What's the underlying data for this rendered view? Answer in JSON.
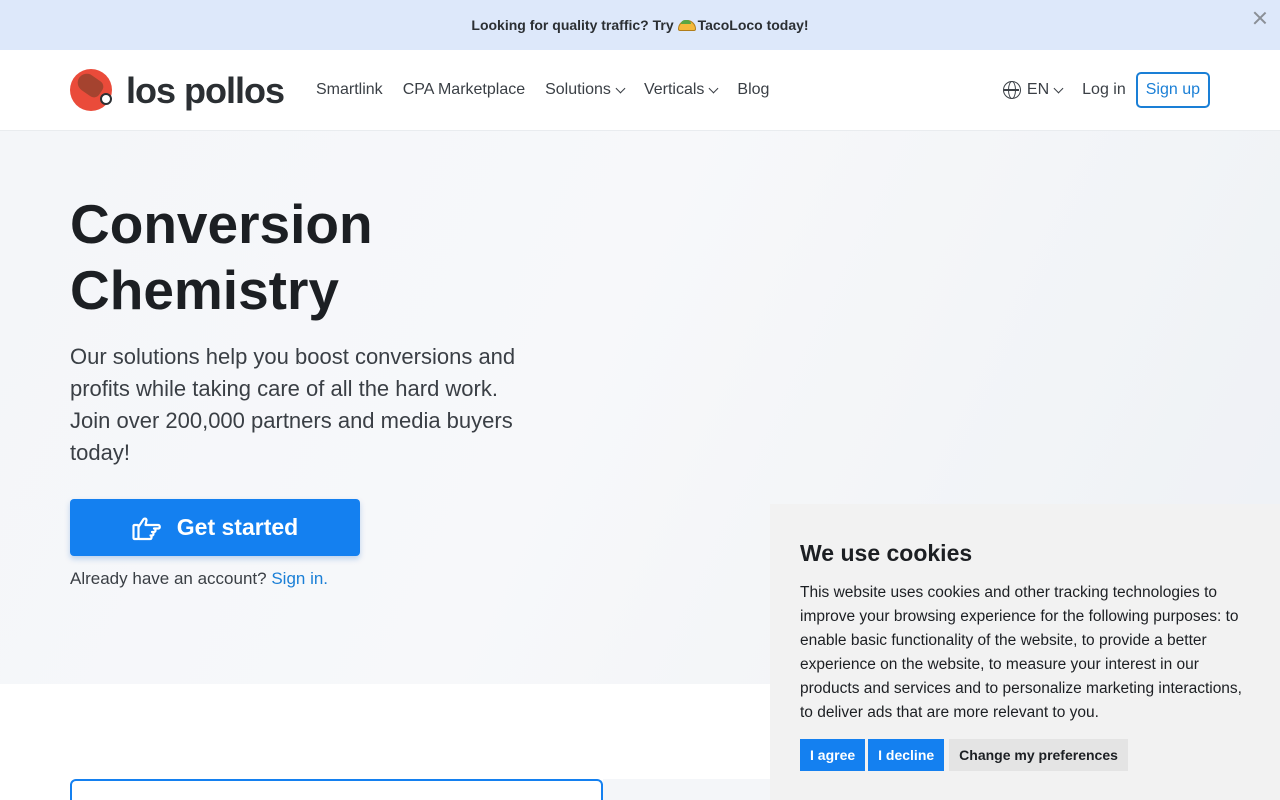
{
  "promo": {
    "text_before": "Looking for quality traffic? Try",
    "text_after": "TacoLoco today!"
  },
  "navbar": {
    "logo_text": "los pollos",
    "links": [
      {
        "label": "Smartlink",
        "dropdown": false
      },
      {
        "label": "CPA Marketplace",
        "dropdown": false
      },
      {
        "label": "Solutions",
        "dropdown": true
      },
      {
        "label": "Verticals",
        "dropdown": true
      },
      {
        "label": "Blog",
        "dropdown": false
      }
    ],
    "language": "EN",
    "login_label": "Log in",
    "signup_label": "Sign up"
  },
  "hero": {
    "title": "Conversion Chemistry",
    "subtitle": "Our solutions help you boost conversions and profits while taking care of all the hard work. Join over 200,000 partners and media buyers today!",
    "cta_label": "Get started",
    "account_prompt": "Already have an account?",
    "signin_label": "Sign in."
  },
  "cookie_banner": {
    "title": "We use cookies",
    "body": "This website uses cookies and other tracking technologies to improve your browsing experience for the following purposes: to enable basic functionality of the website, to provide a better experience on the website, to measure your interest in our products and services and to personalize marketing interactions, to deliver ads that are more relevant to you.",
    "agree_label": "I agree",
    "decline_label": "I decline",
    "preferences_label": "Change my preferences"
  },
  "colors": {
    "accent": "#1480f0",
    "promo_bg": "#dde8fa",
    "logo_red": "#ea4b3a"
  },
  "icons": [
    "close-icon",
    "logo-drumstick-icon",
    "chevron-down-icon",
    "globe-icon",
    "thumb-pointing-icon",
    "taco-icon"
  ]
}
